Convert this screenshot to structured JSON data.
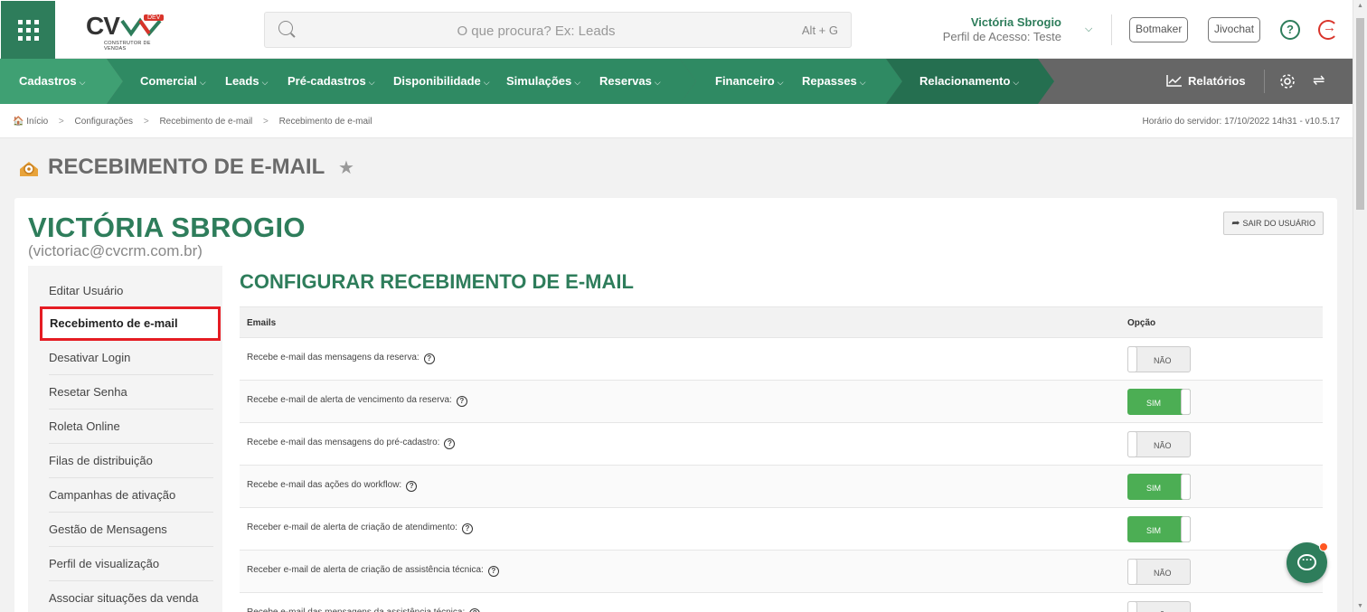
{
  "header": {
    "logo_text": "CV",
    "logo_badge": "DEV",
    "logo_subtitle": "CONSTRUTOR DE VENDAS",
    "search_placeholder": "O que procura? Ex: Leads",
    "search_shortcut": "Alt + G",
    "user_name": "Victória Sbrogio",
    "user_profile": "Perfil de Acesso: Teste",
    "buttons": [
      "Botmaker",
      "Jivochat"
    ]
  },
  "nav": {
    "items": [
      "Cadastros",
      "Comercial",
      "Leads",
      "Pré-cadastros",
      "Disponibilidade",
      "Simulações",
      "Reservas",
      "Financeiro",
      "Repasses",
      "Relacionamento"
    ],
    "reports": "Relatórios",
    "colors": {
      "green1": "#3fa073",
      "green2": "#2f8a63",
      "green3": "#256f50",
      "gray": "#666666"
    }
  },
  "breadcrumb": {
    "items": [
      "Início",
      "Configurações",
      "Recebimento de e-mail",
      "Recebimento de e-mail"
    ],
    "server_time": "Horário do servidor: 17/10/2022 14h31 - v10.5.17"
  },
  "page": {
    "title": "RECEBIMENTO DE E-MAIL",
    "user_big_name": "VICTÓRIA SBROGIO",
    "user_email": "(victoriac@cvcrm.com.br)",
    "exit_button": "SAIR DO USUÁRIO",
    "section_title": "CONFIGURAR RECEBIMENTO DE E-MAIL"
  },
  "sidemenu": [
    "Editar Usuário",
    "Recebimento de e-mail",
    "Desativar Login",
    "Resetar Senha",
    "Roleta Online",
    "Filas de distribuição",
    "Campanhas de ativação",
    "Gestão de Mensagens",
    "Perfil de visualização",
    "Associar situações da venda"
  ],
  "table": {
    "headers": [
      "Emails",
      "Opção"
    ],
    "rows": [
      {
        "label": "Recebe e-mail das mensagens da reserva:",
        "value": "NÃO",
        "on": false
      },
      {
        "label": "Recebe e-mail de alerta de vencimento da reserva:",
        "value": "SIM",
        "on": true
      },
      {
        "label": "Recebe e-mail das mensagens do pré-cadastro:",
        "value": "NÃO",
        "on": false
      },
      {
        "label": "Recebe e-mail das ações do workflow:",
        "value": "SIM",
        "on": true
      },
      {
        "label": "Receber e-mail de alerta de criação de atendimento:",
        "value": "SIM",
        "on": true
      },
      {
        "label": "Receber e-mail de alerta de criação de assistência técnica:",
        "value": "NÃO",
        "on": false
      },
      {
        "label": "Recebe e-mail das mensagens da assistência técnica:",
        "value": "NÃO",
        "on": false
      }
    ]
  }
}
